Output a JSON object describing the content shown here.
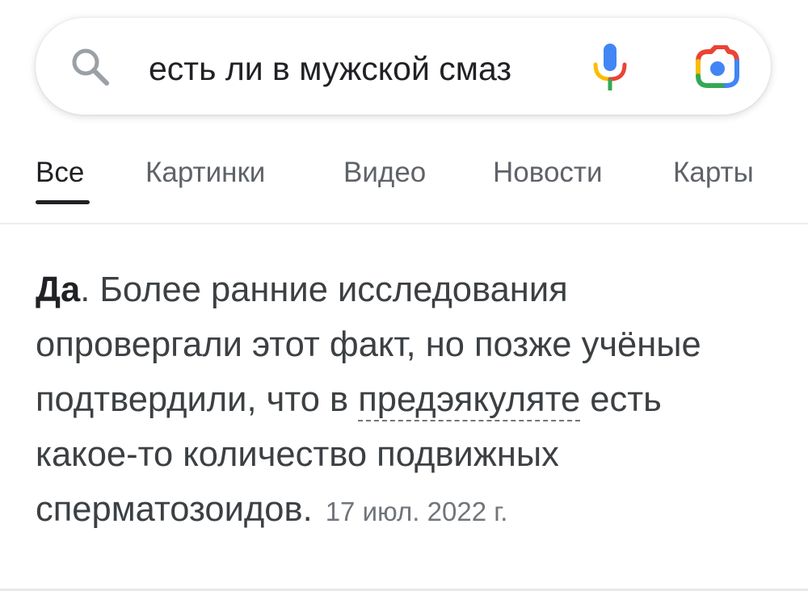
{
  "search": {
    "query": "есть ли в мужской смаз"
  },
  "icons": {
    "search": "search-icon",
    "mic": "microphone-icon",
    "lens": "google-lens-camera-icon"
  },
  "colors": {
    "google_blue": "#4285f4",
    "google_red": "#ea4335",
    "google_yellow": "#fbbc04",
    "google_green": "#34a853",
    "text_primary": "#202124",
    "text_secondary": "#5f6368"
  },
  "tabs": [
    {
      "label": "Все",
      "active": true
    },
    {
      "label": "Картинки",
      "active": false
    },
    {
      "label": "Видео",
      "active": false
    },
    {
      "label": "Новости",
      "active": false
    },
    {
      "label": "Карты",
      "active": false
    }
  ],
  "answer": {
    "highlight": "Да",
    "text_before_term": ". Более ранние исследования опровергали этот факт, но позже учёные подтвердили, что в ",
    "term": "предэякуляте",
    "text_after_term": " есть какое-то количество подвижных сперматозоидов.",
    "date": "17 июл. 2022 г."
  }
}
